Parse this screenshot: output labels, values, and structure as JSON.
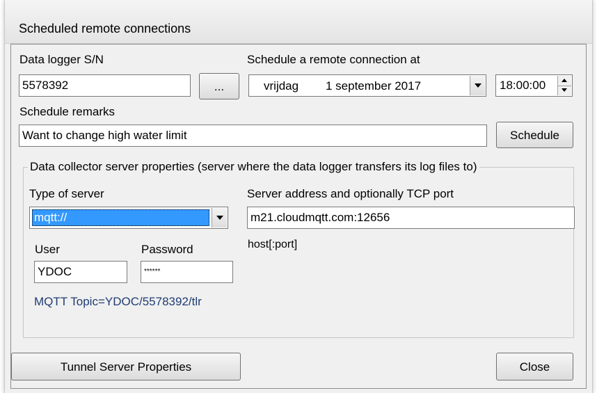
{
  "window": {
    "title": "Scheduled remote connections"
  },
  "logger": {
    "label": "Data logger S/N",
    "value": "5578392",
    "browse_label": "..."
  },
  "schedule": {
    "label": "Schedule a remote connection at",
    "day": "vrijdag",
    "date": "1 september 2017",
    "time": "18:00:00",
    "remarks_label": "Schedule remarks",
    "remarks_value": "Want to change high water limit",
    "button_label": "Schedule"
  },
  "collector": {
    "group_title": "Data collector server properties (server where the data logger transfers its log files to)",
    "server_type_label": "Type of server",
    "server_type_value": "mqtt://",
    "address_label": "Server address and optionally TCP port",
    "address_value": "m21.cloudmqtt.com:12656",
    "address_hint": "host[:port]",
    "user_label": "User",
    "user_value": "YDOC",
    "password_label": "Password",
    "password_value": "******",
    "topic_text": "MQTT Topic=YDOC/5578392/tlr",
    "topic_color": "#1f3c74"
  },
  "footer": {
    "tunnel_button": "Tunnel Server Properties",
    "close_button": "Close"
  }
}
